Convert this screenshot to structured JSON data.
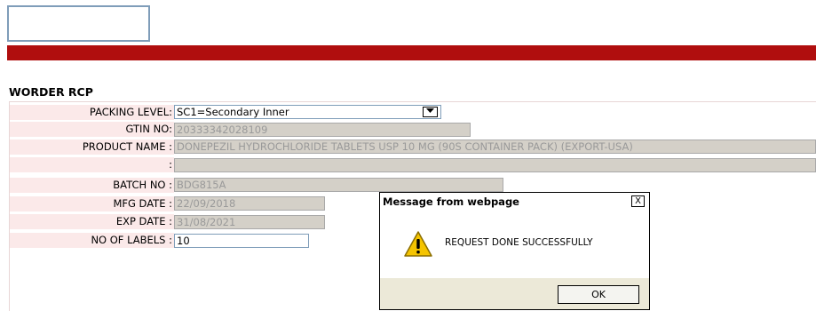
{
  "section_title": "WORDER RCP",
  "form": {
    "packing_level": {
      "label": "PACKING LEVEL:",
      "value": "SC1=Secondary Inner"
    },
    "gtin_no": {
      "label": "GTIN NO:",
      "value": "20333342028109"
    },
    "product_name": {
      "label": "PRODUCT NAME :",
      "value": "DONEPEZIL HYDROCHLORIDE TABLETS USP 10 MG (90S CONTAINER PACK) (EXPORT-USA)"
    },
    "extra": {
      "label": ":",
      "value": ""
    },
    "batch_no": {
      "label": "BATCH NO :",
      "value": "BDG815A"
    },
    "mfg_date": {
      "label": "MFG DATE :",
      "value": "22/09/2018"
    },
    "exp_date": {
      "label": "EXP DATE :",
      "value": "31/08/2021"
    },
    "no_of_labels": {
      "label": "NO OF LABELS :",
      "value": "10"
    }
  },
  "dialog": {
    "title": "Message from webpage",
    "close_glyph": "X",
    "message": "REQUEST DONE SUCCESSFULLY",
    "ok_label": "OK"
  },
  "colors": {
    "brand_bar": "#b00e0e",
    "label_bg": "#fbe9e9",
    "disabled_field_bg": "#d4d0c8"
  },
  "icons": {
    "dropdown": "chevron-down-icon",
    "dialog_icon": "warning-icon"
  }
}
